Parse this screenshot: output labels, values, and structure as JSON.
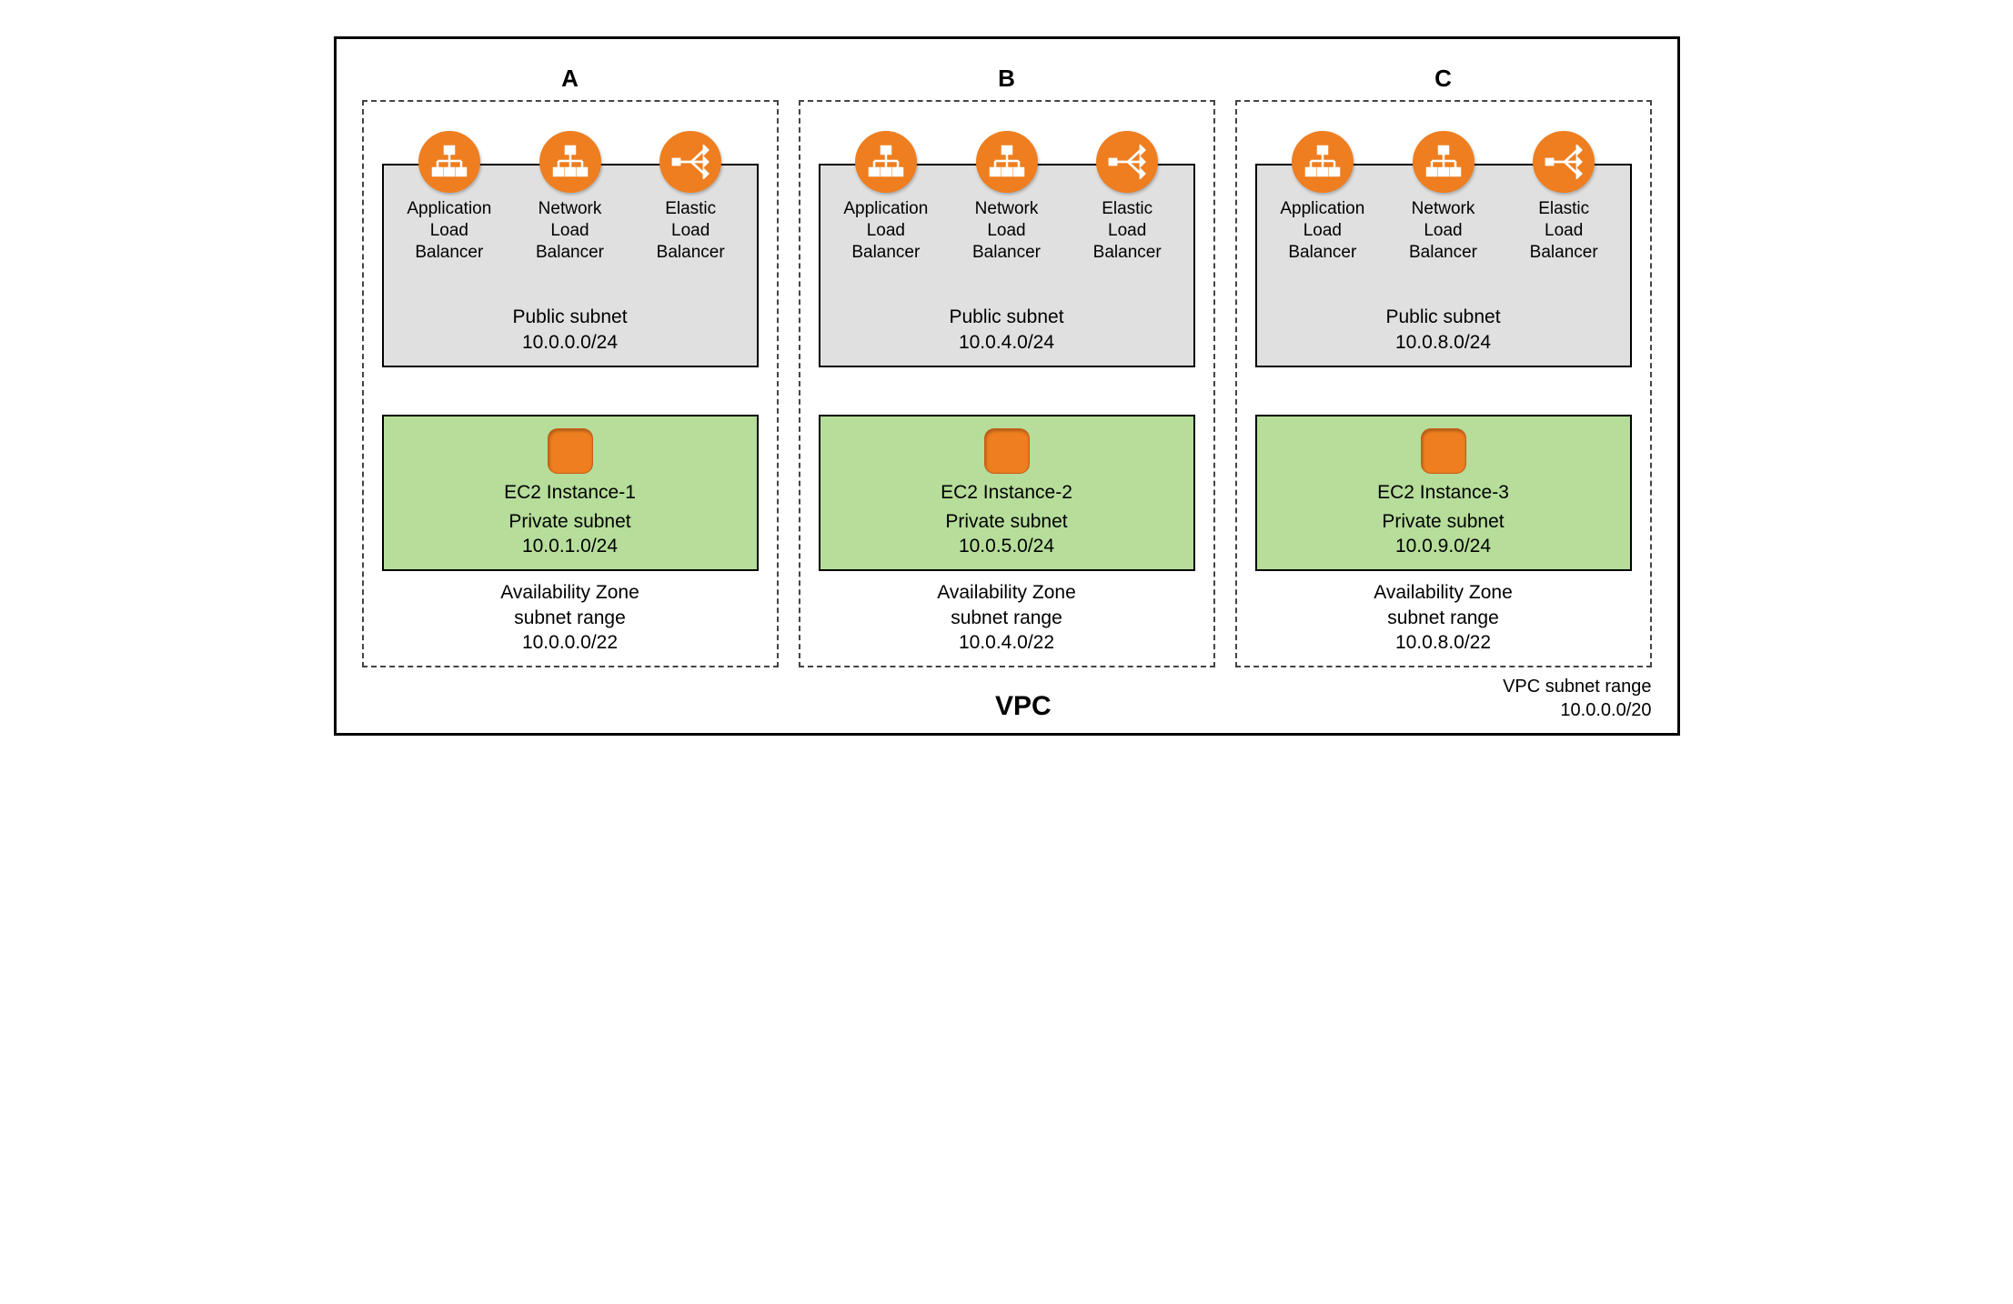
{
  "vpc": {
    "title": "VPC",
    "range_label": "VPC subnet range",
    "range_cidr": "10.0.0.0/20"
  },
  "lb_labels": {
    "app_l1": "Application",
    "app_l2": "Load",
    "app_l3": "Balancer",
    "net_l1": "Network",
    "net_l2": "Load",
    "net_l3": "Balancer",
    "elb_l1": "Elastic",
    "elb_l2": "Load",
    "elb_l3": "Balancer"
  },
  "public_label": "Public subnet",
  "private_label": "Private subnet",
  "az_label_l1": "Availability Zone",
  "az_label_l2": "subnet range",
  "zones": {
    "a": {
      "letter": "A",
      "public_cidr": "10.0.0.0/24",
      "ec2_label": "EC2 Instance-1",
      "private_cidr": "10.0.1.0/24",
      "az_cidr": "10.0.0.0/22"
    },
    "b": {
      "letter": "B",
      "public_cidr": "10.0.4.0/24",
      "ec2_label": "EC2 Instance-2",
      "private_cidr": "10.0.5.0/24",
      "az_cidr": "10.0.4.0/22"
    },
    "c": {
      "letter": "C",
      "public_cidr": "10.0.8.0/24",
      "ec2_label": "EC2 Instance-3",
      "private_cidr": "10.0.9.0/24",
      "az_cidr": "10.0.8.0/22"
    }
  }
}
